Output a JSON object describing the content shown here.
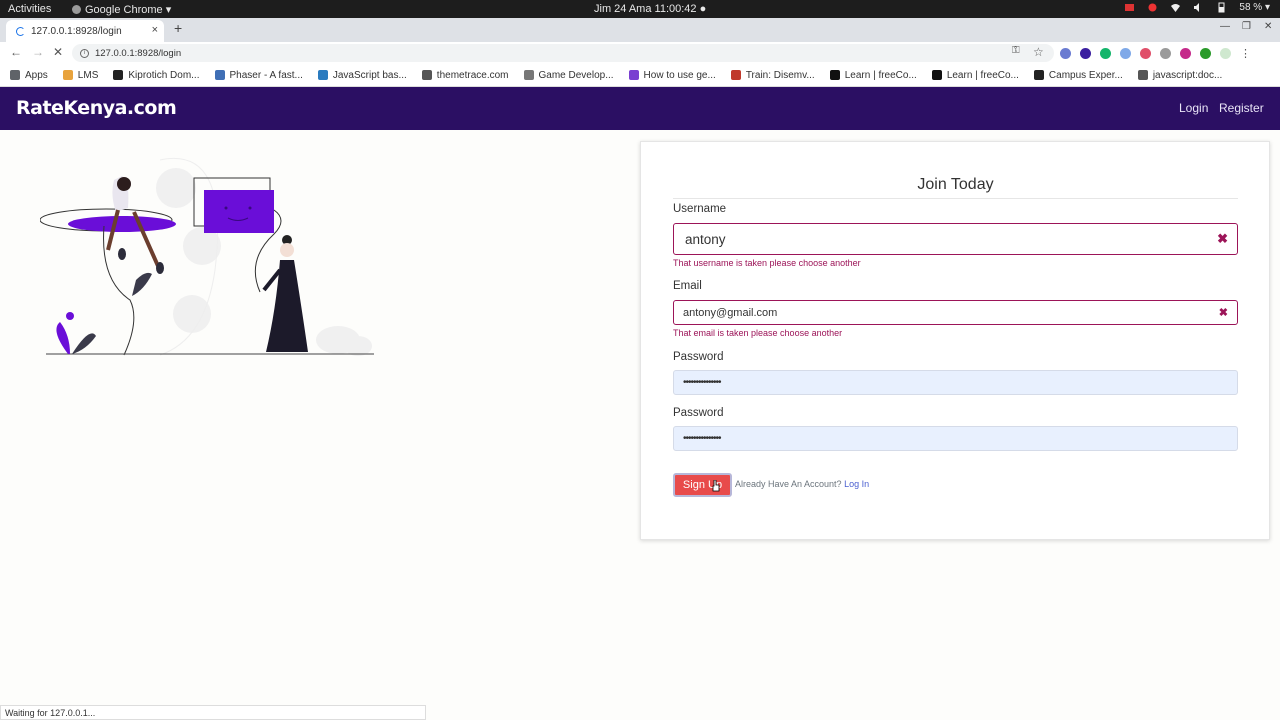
{
  "os_bar": {
    "activities": "Activities",
    "app_name": "Google Chrome ▾",
    "clock": "Jim 24 Ama  11:00:42 ●",
    "battery": "58 % ▾"
  },
  "browser": {
    "tab_title": "127.0.0.1:8928/login",
    "tab_close": "×",
    "new_tab": "+",
    "url": "127.0.0.1:8928/login",
    "status_text": "Waiting for 127.0.0.1...",
    "bookmarks": [
      {
        "label": "Apps",
        "color": "#5f6368"
      },
      {
        "label": "LMS",
        "color": "#e8a33d"
      },
      {
        "label": "Kiprotich Dom...",
        "color": "#222222"
      },
      {
        "label": "Phaser - A fast...",
        "color": "#3f6fb5"
      },
      {
        "label": "JavaScript bas...",
        "color": "#2a7bbf"
      },
      {
        "label": "themetrace.com",
        "color": "#555555"
      },
      {
        "label": "Game Develop...",
        "color": "#777777"
      },
      {
        "label": "How to use ge...",
        "color": "#7a3fd1"
      },
      {
        "label": "Train: Disemv...",
        "color": "#c0392b"
      },
      {
        "label": "Learn | freeCo...",
        "color": "#111111"
      },
      {
        "label": "Learn | freeCo...",
        "color": "#111111"
      },
      {
        "label": "Campus Exper...",
        "color": "#222222"
      },
      {
        "label": "javascript:doc...",
        "color": "#555555"
      }
    ]
  },
  "site": {
    "brand": "RateKenya.com",
    "nav_login": "Login",
    "nav_register": "Register",
    "header_color": "#2b0f63"
  },
  "form": {
    "legend": "Join Today",
    "username_label": "Username",
    "username_value": "antony",
    "username_error": "That username is taken please choose another",
    "email_label": "Email",
    "email_value": "antony@gmail.com",
    "email_error": "That email is taken please choose another",
    "password_label": "Password",
    "password_value": "•••••••••••••••",
    "confirm_label": "Password",
    "confirm_value": "•••••••••••••••",
    "submit_label": "Sign Up",
    "already_text": "Already Have An Account?",
    "login_link": "Log In",
    "clear_icon": "✖",
    "error_color": "#9c1458",
    "button_color": "#e84b4b"
  }
}
